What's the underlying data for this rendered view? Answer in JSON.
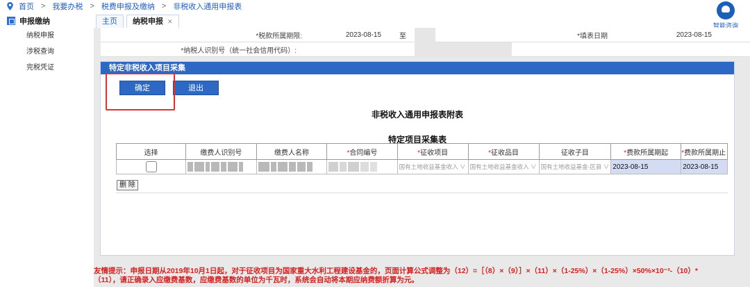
{
  "breadcrumb": [
    "首页",
    "我要办税",
    "税费申报及缴纳",
    "非税收入通用申报表"
  ],
  "helper": {
    "label": "智能咨询"
  },
  "sidebar": {
    "header": "申报缴纳",
    "items": [
      {
        "label": "纳税申报"
      },
      {
        "label": "涉税查询"
      },
      {
        "label": "完税凭证"
      }
    ]
  },
  "tabs": [
    {
      "label": "主页"
    },
    {
      "label": "纳税申报"
    }
  ],
  "form": {
    "period_label": "*税款所属期限:",
    "period_from": "2023-08-15",
    "period_to_prefix": "至",
    "fill_date_label": "*填表日期",
    "fill_date": "2023-08-15",
    "taxpayer_id_label": "*纳税人识别号（统一社会信用代码）:"
  },
  "dialog": {
    "title": "特定非税收入项目采集",
    "confirm_label": "确定",
    "exit_label": "退出",
    "form_title": "非税收入通用申报表附表",
    "table_title": "特定项目采集表"
  },
  "table": {
    "headers": [
      {
        "text": "选择",
        "required": false
      },
      {
        "text": "缴费人识别号",
        "required": false
      },
      {
        "text": "缴费人名称",
        "required": false
      },
      {
        "text": "合同编号",
        "required": true
      },
      {
        "text": "征收项目",
        "required": true
      },
      {
        "text": "征收品目",
        "required": true
      },
      {
        "text": "征收子目",
        "required": false
      },
      {
        "text": "费款所属期起",
        "required": true
      },
      {
        "text": "费款所属期止",
        "required": true
      }
    ],
    "row": {
      "item": "国有土地收益基金收入",
      "category": "国有土地收益基金收入",
      "subcategory": "国有土地收益基金-区县",
      "start": "2023-08-15",
      "end": "2023-08-15"
    },
    "delete_label": "删 除"
  },
  "notice": {
    "line1": "友情提示：申报日期从2019年10月1日起，对于征收项目为国家重大水利工程建设基金的，页面计算公式调整为（12）=［（8）×（9）］×（11）×（1-25%）×（1-25%）×50%×10⁻³-（10）*",
    "line2": "（11），请正确录入应缴费基数，应缴费基数的单位为千瓦时，系统会自动将本期应纳费额折算为元。"
  },
  "colors": {
    "accent": "#2c68c4",
    "link": "#1f5fc3",
    "warning": "#d62020",
    "highlight_box": "#e03030"
  }
}
